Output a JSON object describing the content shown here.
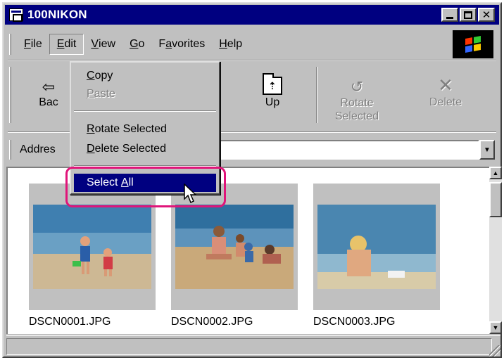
{
  "window": {
    "title": "100NIKON",
    "controls": [
      "minimize",
      "maximize",
      "close"
    ],
    "close_glyph": "✕"
  },
  "menubar": {
    "items": [
      {
        "label": "File",
        "accel": "F",
        "rest": "ile"
      },
      {
        "label": "Edit",
        "accel": "E",
        "rest": "dit"
      },
      {
        "label": "View",
        "accel": "V",
        "rest": "iew"
      },
      {
        "label": "Go",
        "accel": "G",
        "rest": "o"
      },
      {
        "label": "Favorites",
        "accel_pre": "F",
        "accel": "a",
        "rest": "vorites"
      },
      {
        "label": "Help",
        "accel": "H",
        "rest": "elp"
      }
    ],
    "active": "Edit",
    "logo_colors": [
      "#ff3300",
      "#33cc33",
      "#3366ff",
      "#ffcc00"
    ]
  },
  "toolbar": {
    "back_label_visible": "Bac",
    "back_glyph": "⇦",
    "up_label": "Up",
    "up_glyph": "⇡",
    "rotate_label_line1": "Rotate",
    "rotate_label_line2": "Selected",
    "rotate_glyph": "↺",
    "delete_label": "Delete",
    "delete_glyph": "✕",
    "dropdown_glyph": "▾"
  },
  "addressbar": {
    "label_visible": "Addres",
    "value": "",
    "drop_glyph": "▼"
  },
  "edit_menu": {
    "copy": {
      "accel": "C",
      "rest": "opy",
      "enabled": true
    },
    "paste": {
      "accel": "P",
      "rest": "aste",
      "enabled": false
    },
    "rotate_selected": {
      "accel": "R",
      "rest": "otate Selected",
      "enabled": true
    },
    "delete_selected": {
      "accel": "D",
      "rest": "elete Selected",
      "enabled": true
    },
    "select_all": {
      "pre": "Select ",
      "accel": "A",
      "rest": "ll",
      "enabled": true,
      "highlighted": true
    }
  },
  "files": [
    {
      "name": "DSCN0001.JPG",
      "icon": "photo-children-beach"
    },
    {
      "name": "DSCN0002.JPG",
      "icon": "photo-family-sand"
    },
    {
      "name": "DSCN0003.JPG",
      "icon": "photo-girl-beach"
    }
  ],
  "scrollbar": {
    "up_glyph": "▲",
    "down_glyph": "▼"
  },
  "colors": {
    "titlebar": "#000080",
    "window_face": "#c0c0c0",
    "menu_highlight": "#000080",
    "callout_ring": "#e0157a"
  }
}
